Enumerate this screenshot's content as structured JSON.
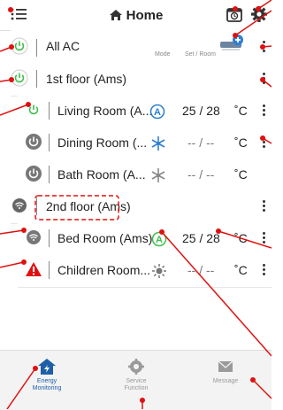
{
  "header": {
    "title": "Home"
  },
  "all_ac": {
    "label": "All AC",
    "col_mode": "Mode",
    "col_set": "Set / Room"
  },
  "floors": [
    {
      "label": "1st floor (Ams)"
    },
    {
      "label": "2nd floor (Ams)"
    }
  ],
  "rooms": [
    {
      "name": "Living Room (A...",
      "mode": "auto",
      "set": "25 / 28",
      "unit": "˚C"
    },
    {
      "name": "Dining Room (...",
      "mode": "cool",
      "set": "-- / --",
      "unit": "˚C"
    },
    {
      "name": "Bath Room (A...",
      "mode": "cool",
      "set": "-- / --",
      "unit": "˚C"
    },
    {
      "name": "Bed Room (Ams)",
      "mode": "auto",
      "set": "25 / 28",
      "unit": "˚C"
    },
    {
      "name": "Children Room...",
      "mode": "heat",
      "set": "-- / --",
      "unit": "˚C"
    }
  ],
  "nav": [
    {
      "label_1": "Energy",
      "label_2": "Monitoring",
      "icon": "energy-house-icon"
    },
    {
      "label_1": "Service",
      "label_2": "Function",
      "icon": "service-gear-icon"
    },
    {
      "label_1": "Message",
      "label_2": "",
      "icon": "envelope-icon"
    }
  ],
  "colors": {
    "accent": "#1e5fa8",
    "power_on": "#3cbf4a",
    "annotation": "#e01010",
    "mode_icon": "#2f7fd0"
  }
}
